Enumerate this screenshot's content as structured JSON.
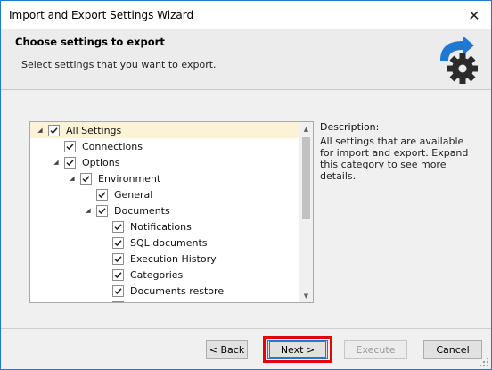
{
  "window": {
    "title": "Import and Export Settings Wizard",
    "close_glyph": "✕"
  },
  "header": {
    "title": "Choose settings to export",
    "subtitle": "Select settings that you want to export.",
    "icon": "settings-export-icon"
  },
  "tree": {
    "items": [
      {
        "label": "All Settings",
        "level": 0,
        "expander": "expanded",
        "checked": true,
        "selected": true
      },
      {
        "label": "Connections",
        "level": 1,
        "expander": "none",
        "checked": true,
        "selected": false
      },
      {
        "label": "Options",
        "level": 1,
        "expander": "expanded",
        "checked": true,
        "selected": false
      },
      {
        "label": "Environment",
        "level": 2,
        "expander": "expanded",
        "checked": true,
        "selected": false
      },
      {
        "label": "General",
        "level": 3,
        "expander": "none",
        "checked": true,
        "selected": false
      },
      {
        "label": "Documents",
        "level": 3,
        "expander": "expanded",
        "checked": true,
        "selected": false
      },
      {
        "label": "Notifications",
        "level": 4,
        "expander": "none",
        "checked": true,
        "selected": false
      },
      {
        "label": "SQL documents",
        "level": 4,
        "expander": "none",
        "checked": true,
        "selected": false
      },
      {
        "label": "Execution History",
        "level": 4,
        "expander": "none",
        "checked": true,
        "selected": false
      },
      {
        "label": "Categories",
        "level": 4,
        "expander": "none",
        "checked": true,
        "selected": false
      },
      {
        "label": "Documents restore",
        "level": 4,
        "expander": "none",
        "checked": true,
        "selected": false
      },
      {
        "label": "",
        "level": 4,
        "expander": "none",
        "checked": true,
        "selected": false
      }
    ],
    "scroll_up_glyph": "▲",
    "scroll_down_glyph": "▼"
  },
  "description": {
    "label": "Description:",
    "text": "All settings that are available for import and export. Expand this category to see more details."
  },
  "buttons": {
    "back": "< Back",
    "next": "Next >",
    "execute": "Execute",
    "cancel": "Cancel"
  },
  "colors": {
    "accent": "#1f78d1",
    "highlight": "#e8000b",
    "selected_row": "#fcf3d7"
  }
}
